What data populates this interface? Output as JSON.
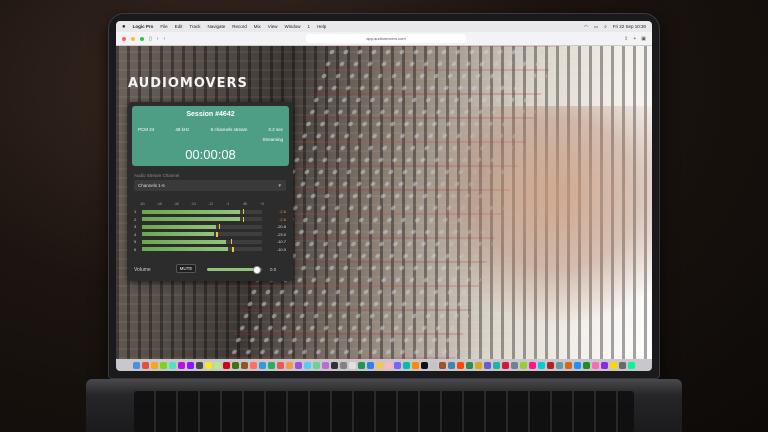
{
  "menubar": {
    "app": "Logic Pro",
    "items": [
      "File",
      "Edit",
      "Track",
      "Navigate",
      "Record",
      "Mix",
      "View",
      "Window",
      "1",
      "Help"
    ],
    "clock": "Fri 22 Sep 10:30"
  },
  "browser": {
    "url": "app.audiomovers.com"
  },
  "brand": "AUDIOMOVERS",
  "session": {
    "title": "Session #4642",
    "format": "PCM 24",
    "sample_rate": "48 kHz",
    "channels_stream": "6 channels stream",
    "latency": "0.2 sec",
    "status": "Streaming",
    "timer": "00:00:08"
  },
  "channel": {
    "label": "Audio Stream Channel",
    "selected": "Channels 1-6"
  },
  "meter_scale": [
    "-60",
    "-48",
    "-36",
    "-24",
    "-12",
    "-3",
    "dB",
    "+3"
  ],
  "meters": [
    {
      "num": "1",
      "db": "-2.6",
      "level": 0.82,
      "peak": 0.84,
      "color": "#e69138"
    },
    {
      "num": "2",
      "db": "-2.6",
      "level": 0.82,
      "peak": 0.84,
      "color": "#e69138"
    },
    {
      "num": "3",
      "db": "-20.8",
      "level": 0.62,
      "peak": 0.64,
      "color": "#dddddd"
    },
    {
      "num": "4",
      "db": "-23.0",
      "level": 0.6,
      "peak": 0.62,
      "color": "#dddddd"
    },
    {
      "num": "5",
      "db": "-10.7",
      "level": 0.7,
      "peak": 0.74,
      "color": "#dddddd"
    },
    {
      "num": "6",
      "db": "-10.0",
      "level": 0.72,
      "peak": 0.75,
      "color": "#dddddd"
    }
  ],
  "volume": {
    "label": "Volume",
    "mute_label": "MUTE",
    "level": 0.9,
    "value": "0.0"
  },
  "colors": {
    "session_card": "#4d9e84",
    "meter_green": "#93c47d",
    "panel_bg": "#2c2c2c"
  },
  "dock_colors": [
    "#4a90e2",
    "#e94e3c",
    "#f5a623",
    "#7ed321",
    "#50e3c2",
    "#bd10e0",
    "#9013fe",
    "#4a4a4a",
    "#f8e71c",
    "#b8e986",
    "#d0021b",
    "#417505",
    "#8b572a",
    "#ff6f61",
    "#2d9cdb",
    "#27ae60",
    "#eb5757",
    "#f2994a",
    "#9b51e0",
    "#56ccf2",
    "#6fcf97",
    "#bb6bd9",
    "#333333",
    "#828282",
    "#e0e0e0",
    "#219653",
    "#2f80ed",
    "#f2c94c",
    "#ffb6c1",
    "#7b61ff",
    "#00bfa6",
    "#ff8a00",
    "#111111",
    "#c4c4c4",
    "#a0522d",
    "#4682b4",
    "#ff4500",
    "#2e8b57",
    "#daa520",
    "#6a5acd",
    "#20b2aa",
    "#dc143c",
    "#708090",
    "#9acd32",
    "#ff1493",
    "#00ced1",
    "#b22222",
    "#5f9ea0",
    "#d2691e",
    "#1e90ff",
    "#228b22",
    "#ff69b4",
    "#8a2be2",
    "#ffd700",
    "#696969",
    "#00fa9a"
  ]
}
